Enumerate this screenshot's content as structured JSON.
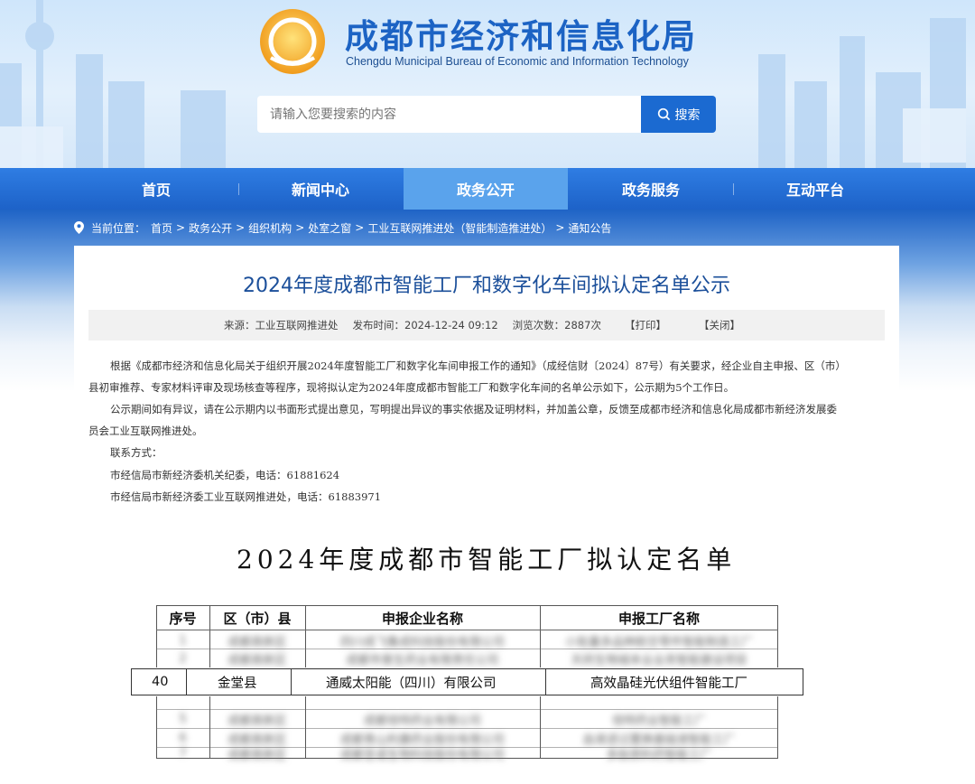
{
  "header": {
    "title": "成都市经济和信息化局",
    "subtitle": "Chengdu Municipal Bureau of Economic and Information Technology",
    "search_placeholder": "请输入您要搜索的内容",
    "search_label": "搜索"
  },
  "nav": {
    "items": [
      {
        "label": "首页"
      },
      {
        "label": "新闻中心"
      },
      {
        "label": "政务公开"
      },
      {
        "label": "政务服务"
      },
      {
        "label": "互动平台"
      }
    ],
    "active_index": 2
  },
  "breadcrumb": {
    "prefix": "当前位置：",
    "items": [
      "首页",
      "政务公开",
      "组织机构",
      "处室之窗",
      "工业互联网推进处（智能制造推进处）",
      "通知公告"
    ],
    "separator": ">"
  },
  "article": {
    "title": "2024年度成都市智能工厂和数字化车间拟认定名单公示",
    "source": "来源：工业互联网推进处",
    "publish_time": "发布时间：2024-12-24 09:12",
    "views": "浏览次数：2887次",
    "print_label": "【打印】",
    "close_label": "【关闭】",
    "paragraphs": [
      "根据《成都市经济和信息化局关于组织开展2024年度智能工厂和数字化车间申报工作的通知》（成经信财〔2024〕87号）有关要求，经企业自主申报、区（市）",
      "县初审推荐、专家材料评审及现场核查等程序，现将拟认定为2024年度成都市智能工厂和数字化车间的名单公示如下，公示期为5个工作日。",
      "公示期间如有异议，请在公示期内以书面形式提出意见，写明提出异议的事实依据及证明材料，并加盖公章，反馈至成都市经济和信息化局成都市新经济发展委",
      "员会工业互联网推进处。",
      "联系方式：",
      "市经信局市新经济委机关纪委，电话：61881624",
      "市经信局市新经济委工业互联网推进处，电话：61883971"
    ]
  },
  "scan": {
    "title": "2024年度成都市智能工厂拟认定名单",
    "headers": [
      "序号",
      "区（市）县",
      "申报企业名称",
      "申报工厂名称"
    ],
    "highlight_row": [
      "40",
      "金堂县",
      "通威太阳能（四川）有限公司",
      "高效晶硅光伏组件智能工厂"
    ],
    "blurred_rows": [
      [
        "1",
        "成都高新区",
        "四川成飞集成科技股份有限公司",
        "小批量多品种航空零件智能制造工厂"
      ],
      [
        "2",
        "成都高新区",
        "成都市普生药业有限责任公司",
        "天府生物城本业业务智能建设项目"
      ],
      [
        "5",
        "成都高新区",
        "成都倍特药业有限公司",
        "倍特药业智能工厂"
      ],
      [
        "6",
        "成都高新区",
        "成都青山利康药业股份有限公司",
        "血液滤过置换基础液智能工厂"
      ],
      [
        "7",
        "成都高新区",
        "成都圣诺生物科技股份有限公司",
        "多肽原料药智能工厂"
      ]
    ]
  },
  "colors": {
    "brand_blue": "#1b6ad1",
    "title_blue": "#1b4f9a",
    "nav_active": "#5aa3ec"
  }
}
